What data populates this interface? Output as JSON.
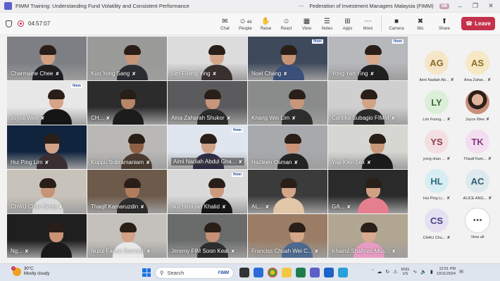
{
  "window": {
    "title": "FIMM Training: Understanding Fund Volatility and Consistent Performance",
    "org": "Federation of Investment Managers Malaysia (FIMM)",
    "org_badge": "SB"
  },
  "meeting": {
    "timer": "04:57:07"
  },
  "toolbar": {
    "items": [
      {
        "label": "Chat",
        "icon": "chat-icon",
        "glyph": "✉"
      },
      {
        "label": "People",
        "icon": "people-icon",
        "glyph": "☺",
        "count": "44"
      },
      {
        "label": "Raise",
        "icon": "hand-icon",
        "glyph": "✋"
      },
      {
        "label": "React",
        "icon": "react-icon",
        "glyph": "☺"
      },
      {
        "label": "View",
        "icon": "view-icon",
        "glyph": "▦"
      },
      {
        "label": "Notes",
        "icon": "notes-icon",
        "glyph": "☰"
      },
      {
        "label": "Apps",
        "icon": "apps-icon",
        "glyph": "⊞"
      },
      {
        "label": "More",
        "icon": "more-icon",
        "glyph": "⋯"
      }
    ],
    "camera_label": "Camera",
    "mic_label": "Mic",
    "share_label": "Share",
    "leave_label": "Leave"
  },
  "tiles": [
    {
      "name": "Charmaine Chee",
      "bg": "#7d7f84",
      "skin": "#d1a083",
      "shirt": "#1f1f22"
    },
    {
      "name": "Kuo Yong Sang",
      "bg": "#9a9a98",
      "skin": "#c99579",
      "shirt": "#2a2d33"
    },
    {
      "name": "Lim Foong Ying",
      "bg": "#dcdcdc",
      "skin": "#d3a68b",
      "shirt": "#3b3030"
    },
    {
      "name": "Noel Chang",
      "bg": "#3e4a5c",
      "skin": "#c89374",
      "shirt": "#3a4f7a",
      "fimm": true
    },
    {
      "name": "Yong Yan Ying",
      "bg": "#b7b8bb",
      "skin": "#d8a98c",
      "shirt": "#202020",
      "fimm": true
    },
    {
      "name": "Joyce Wee",
      "bg": "#e7e7e7",
      "skin": "#d7a386",
      "shirt": "#151515",
      "fimm": true
    },
    {
      "name": "CH...",
      "bg": "#2c2c2d",
      "skin": "#b78668",
      "shirt": "#1c1c1c"
    },
    {
      "name": "Aina Zaharah Shukor",
      "bg": "#5b5b5e",
      "skin": "#c9957a",
      "shirt": "#2b2b2b"
    },
    {
      "name": "Khang Wei Lim",
      "bg": "#8a8c8c",
      "skin": "#c99679",
      "shirt": "#2d2d2d"
    },
    {
      "name": "Cantika Subagio FIMM",
      "bg": "#cfcfcf",
      "skin": "#d2a285",
      "shirt": "#2a2a2a"
    },
    {
      "name": "Hui Ping Lim",
      "bg": "#10243e",
      "skin": "#d3a387",
      "shirt": "#3a2e33"
    },
    {
      "name": "Kuppu Subramaniam",
      "bg": "#b9b8b5",
      "skin": "#8e5f45",
      "shirt": "#4a3a2f"
    },
    {
      "name": "Aimi Nadiah Abdul Gha...",
      "bg": "#dfe6ef",
      "skin": "#cfa088",
      "shirt": "#2e2b45",
      "fimm": true,
      "highlight": true
    },
    {
      "name": "Hazleen Osman",
      "bg": "#a7a9ad",
      "skin": "#c99479",
      "shirt": "#232323"
    },
    {
      "name": "Yap Kien Lex",
      "bg": "#d6d6d2",
      "skin": "#c89678",
      "shirt": "#1a1a1a"
    },
    {
      "name": "CHAU Chun Seng",
      "bg": "#c8c3ba",
      "skin": "#c79377",
      "shirt": "#d9d9d9"
    },
    {
      "name": "Thaqif Kamaruzdin",
      "bg": "#6d5a4a",
      "skin": "#b27d5f",
      "shirt": "#2c2c2c"
    },
    {
      "name": "Nur Hidayah Khalid",
      "bg": "#d9d9d9",
      "skin": "#cc9b7e",
      "shirt": "#151515",
      "fimm": true
    },
    {
      "name": "AL...",
      "bg": "#3b3b3c",
      "skin": "#d5a489",
      "shirt": "#e2c6a8"
    },
    {
      "name": "GA...",
      "bg": "#2b2a2a",
      "skin": "#d0a083",
      "shirt": "#e57e8f"
    },
    {
      "name": "Ng...",
      "bg": "#1f1f20",
      "skin": "#c99376",
      "shirt": "#1a1a1a"
    },
    {
      "name": "Nurul Farina Sumardi",
      "bg": "#c4c1bc",
      "skin": "#d2a187",
      "shirt": "#e8e8e8"
    },
    {
      "name": "Jeremy FIM Soon Keat",
      "bg": "#6a6b6b",
      "skin": "#c49175",
      "shirt": "#2d2d2d"
    },
    {
      "name": "Franciss Chuah Wei C...",
      "bg": "#9b7d66",
      "skin": "#d4a68a",
      "shirt": "#4d6a8f"
    },
    {
      "name": "Khairul Shafinas Mus...",
      "bg": "#b0a692",
      "skin": "#d8aa90",
      "shirt": "#e79bc3"
    }
  ],
  "side_participants": [
    {
      "initials": "AG",
      "name": "Aimi Nadiah Ab...",
      "bg": "#f5e6c8",
      "fg": "#8a6a2a"
    },
    {
      "initials": "AS",
      "name": "Aina Zahar...",
      "bg": "#f6e8c3",
      "fg": "#8a6d2a"
    },
    {
      "initials": "LY",
      "name": "Lim Foong ...",
      "bg": "#dbeed7",
      "fg": "#3d6b35"
    },
    {
      "initials": "",
      "name": "Joyce Wee",
      "bg": "#c98f7a",
      "fg": "#ffffff",
      "photo": true
    },
    {
      "initials": "YS",
      "name": "yong shan ...",
      "bg": "#f3dfe1",
      "fg": "#8a3d48"
    },
    {
      "initials": "TK",
      "name": "Thaqif Kam...",
      "bg": "#f2def0",
      "fg": "#86397c"
    },
    {
      "initials": "HL",
      "name": "Hui Ping Li...",
      "bg": "#d8edf2",
      "fg": "#2c6b7c"
    },
    {
      "initials": "AC",
      "name": "ALICE ANG...",
      "bg": "#dde9ee",
      "fg": "#2e5b6f"
    },
    {
      "initials": "CS",
      "name": "CHAU Chu...",
      "bg": "#e4e0f1",
      "fg": "#4b3f86"
    },
    {
      "initials": "⋯",
      "name": "View all",
      "bg": "#ffffff",
      "fg": "#333333",
      "viewall": true
    }
  ],
  "taskbar": {
    "temp": "30°C",
    "weather": "Mostly cloudy",
    "search_placeholder": "Search",
    "search_logo": "FIMM",
    "lang1": "ENG",
    "lang2": "US",
    "time": "12:51 PM",
    "date": "19/11/2024",
    "notif_count": "1"
  }
}
